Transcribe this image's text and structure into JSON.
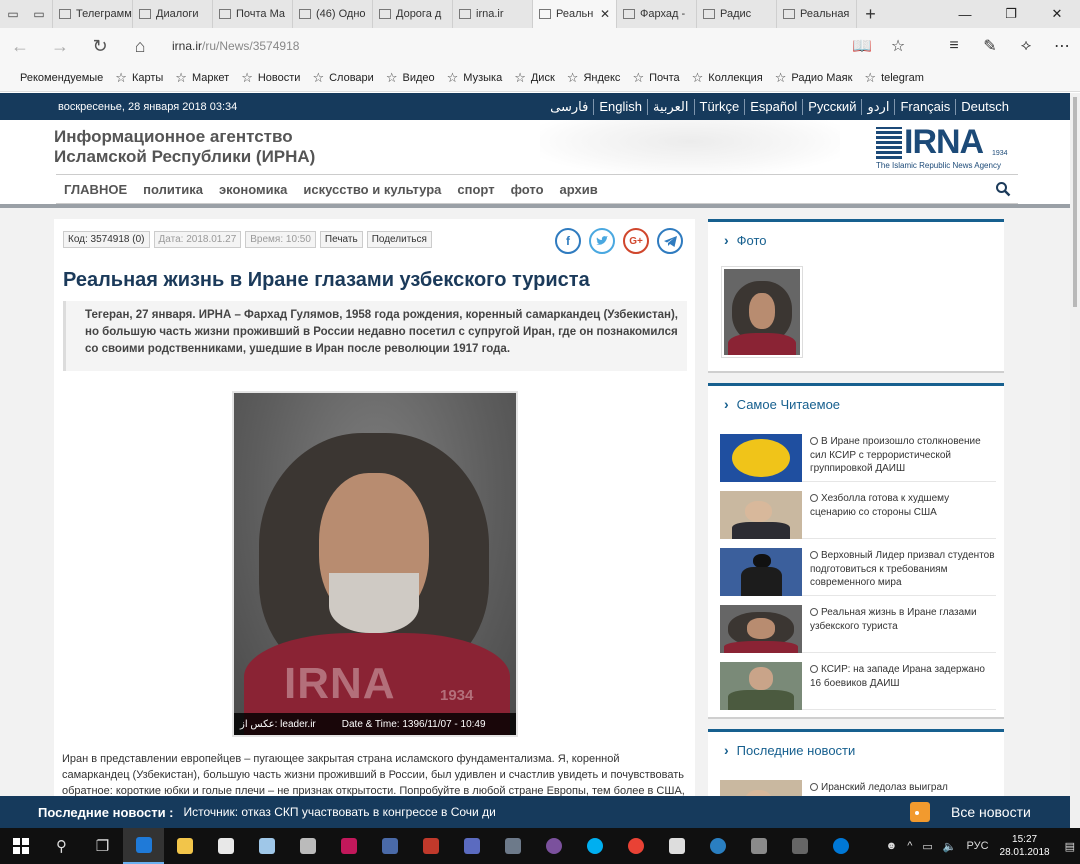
{
  "browser": {
    "tabs": [
      {
        "label": "Телеграмм",
        "active": false
      },
      {
        "label": "Диалоги",
        "active": false
      },
      {
        "label": "Почта Ма",
        "active": false
      },
      {
        "label": "(46) Одно",
        "active": false
      },
      {
        "label": "Дорога д",
        "active": false
      },
      {
        "label": "irna.ir",
        "active": false
      },
      {
        "label": "Реальн",
        "active": true
      },
      {
        "label": "Фархад - ",
        "active": false
      },
      {
        "label": "Радис",
        "active": false
      },
      {
        "label": "Реальная",
        "active": false
      }
    ],
    "url_host": "irna.ir",
    "url_path": "/ru/News/3574918",
    "favorites": [
      "Рекомендуемые",
      "Карты",
      "Маркет",
      "Новости",
      "Словари",
      "Видео",
      "Музыка",
      "Диск",
      "Яндекс",
      "Почта",
      "Коллекция",
      "Радио Маяк",
      "telegram"
    ]
  },
  "site": {
    "date": "воскресенье, 28 января 2018 03:34",
    "languages": [
      "فارسی",
      "English",
      "العربية",
      "Türkçe",
      "Español",
      "Русский",
      "اردو",
      "Français",
      "Deutsch"
    ],
    "agency_line1": "Информационное агентство",
    "agency_line2": "Исламской Республики (ИРНА)",
    "logo_word": "IRNA",
    "logo_year": "1934",
    "logo_tagline": "The Islamic Republic News Agency",
    "menu": [
      "ГЛАВНОЕ",
      "политика",
      "экономика",
      "искусство и культура",
      "спорт",
      "фото",
      "архив"
    ]
  },
  "article": {
    "code": "Код: 3574918 (0)",
    "date": "Дата: 2018.01.27",
    "time": "Время: 10:50",
    "print": "Печать",
    "share": "Поделиться",
    "title": "Реальная жизнь в Иране глазами узбекского туриста",
    "lead": "Тегеран, 27 января. ИРНА – Фархад Гулямов, 1958 года рождения, коренный самаркандец (Узбекистан), но большую часть жизни проживший в России недавно посетил с супругой Иран, где он познакомился со своими родственниками, ушедшие в Иран после революции 1917 года.",
    "photo_watermark": "IRNA",
    "photo_watermark_year": "1934",
    "photo_source": "عکس از: leader.ir",
    "photo_datetime": "Date & Time: 1396/11/07 - 10:49",
    "body": "Иран в представлении европейцев – пугающее закрытая страна исламского фундаментализма. Я, коренной самаркандец (Узбекистан), большую часть жизни проживший в России, был удивлен и счастлив увидеть и почувствовать обратное: короткие юбки и голые плечи – не признак открытости. Попробуйте в любой стране Европы, тем более в США, подойти к"
  },
  "sidebar": {
    "photo_title": "Фото",
    "popular_title": "Самое Читаемое",
    "popular": [
      {
        "text": "В Иране произошло столкновение сил КСИР с террористической группировкой ДАИШ",
        "thumb": "flag"
      },
      {
        "text": "Хезболла готова к худшему сценарию со стороны США",
        "thumb": "men"
      },
      {
        "text": "Верховный Лидер призвал студентов подготовиться к требованиям современного мира",
        "thumb": "leader"
      },
      {
        "text": "Реальная жизнь в Иране глазами узбекского туриста",
        "thumb": "portrait"
      },
      {
        "text": "КСИР: на западе Ирана задержано 16 боевиков ДАИШ",
        "thumb": "military"
      }
    ],
    "latest_title": "Последние новости",
    "latest_first": "Иранский ледолаз выиграл"
  },
  "ticker": {
    "label": "Последние новости :",
    "text": "Источник: отказ СКП участвовать в конгрессе в Сочи ди",
    "all_news": "Все новости"
  },
  "taskbar": {
    "lang": "РУС",
    "time": "15:27",
    "date": "28.01.2018"
  },
  "colors": {
    "brand_navy": "#163a5c",
    "link_blue": "#17608f",
    "title_blue": "#1b3a5a"
  }
}
